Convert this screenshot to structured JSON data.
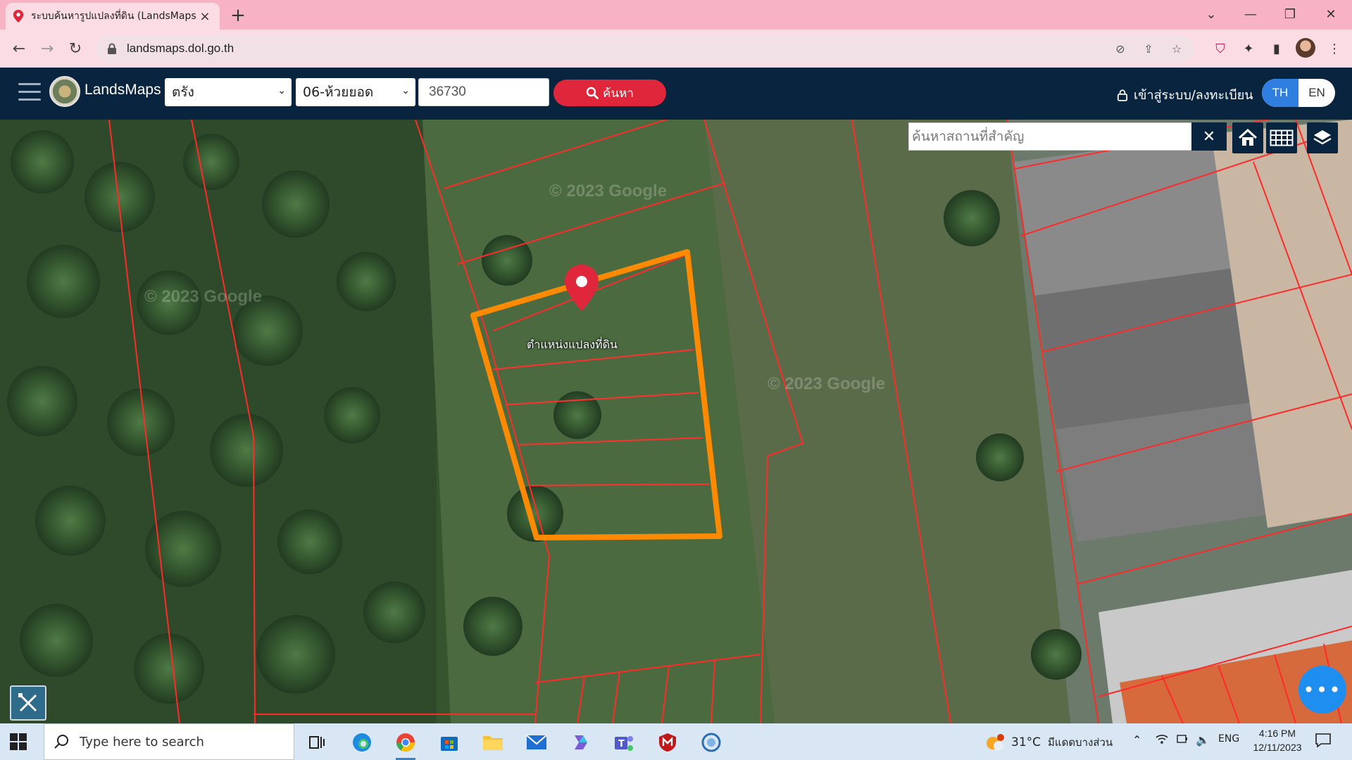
{
  "browser": {
    "tab_title": "ระบบค้นหารูปแปลงที่ดิน (LandsMaps",
    "url": "landsmaps.dol.go.th",
    "colors": {
      "tabstrip": "#f7b3c4",
      "toolbar": "#fbdce4"
    }
  },
  "app": {
    "name": "LandsMaps",
    "province": "ตรัง",
    "district": "06-ห้วยยอด",
    "parcel_number": "36730",
    "search_label": "ค้นหา",
    "login_label": "เข้าสู่ระบบ/ลงทะเบียน",
    "lang_th": "TH",
    "lang_en": "EN",
    "colors": {
      "header": "#08243f",
      "search_button": "#e0263a",
      "lang_active": "#2f7fe0"
    }
  },
  "map": {
    "search_placeholder": "ค้นหาสถานที่สำคัญ",
    "clear_symbol": "✕",
    "pin_label": "ตำแหน่งแปลงที่ดิน",
    "watermark": "© 2023 Google",
    "chat_symbol": "•••",
    "highlight_color": "#ff8a00",
    "parcel_line_color": "#ff2a2a"
  },
  "taskbar": {
    "search_placeholder": "Type here to search",
    "weather_temp": "31°C",
    "weather_text": "มีแดดบางส่วน",
    "lang": "ENG",
    "time": "4:16 PM",
    "date": "12/11/2023"
  }
}
